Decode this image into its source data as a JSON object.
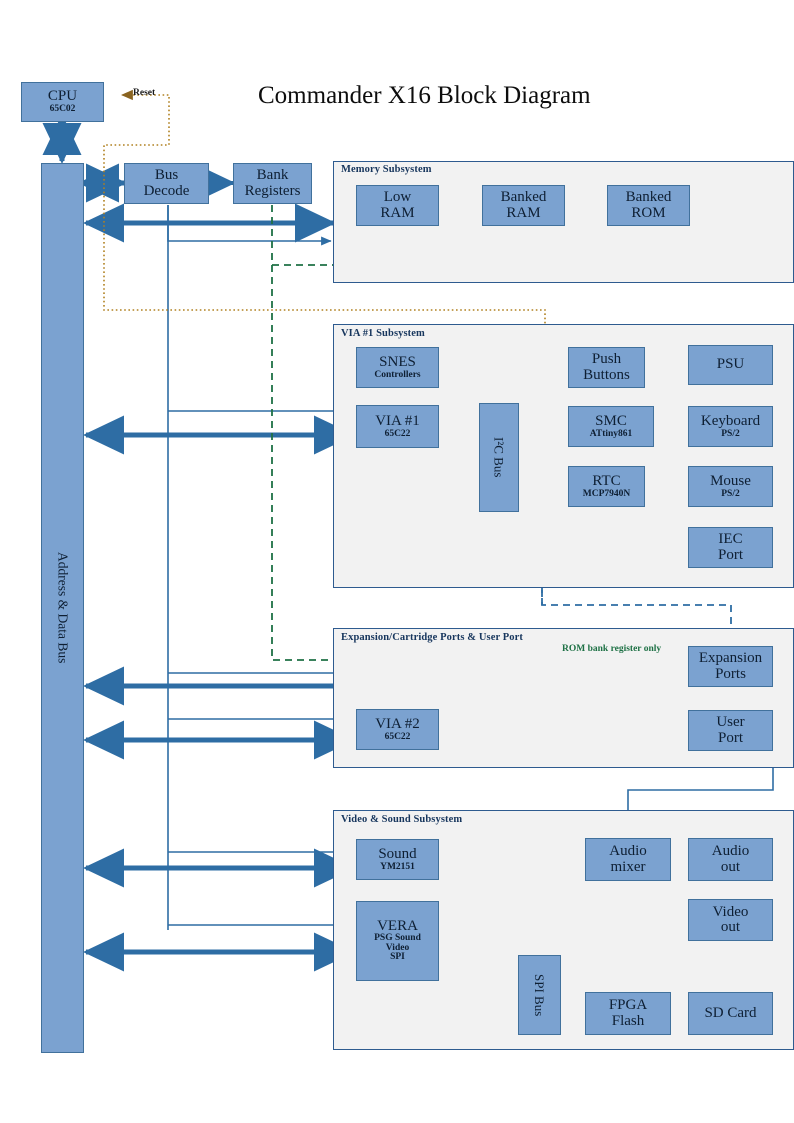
{
  "title": "Commander X16 Block Diagram",
  "colors": {
    "box_fill": "#7ba2d0",
    "box_border": "#41719c",
    "group_fill": "#f2f2f2",
    "group_border": "#2e5b8f",
    "bus_line": "#2e6da4",
    "reset_line": "#b08020",
    "bank_line": "#1e7145",
    "label_text": "#17365d"
  },
  "bus": {
    "label": "Address & Data Bus"
  },
  "cpu": {
    "name": "CPU",
    "part": "65C02"
  },
  "bus_decode": {
    "name": "Bus",
    "name2": "Decode"
  },
  "bank_registers": {
    "name": "Bank",
    "name2": "Registers"
  },
  "wire_labels": {
    "reset": "Reset",
    "rom_bank": "ROM bank register only"
  },
  "groups": [
    {
      "id": "memory",
      "label": "Memory Subsystem"
    },
    {
      "id": "via1",
      "label": "VIA #1 Subsystem"
    },
    {
      "id": "expansion",
      "label": "Expansion/Cartridge Ports & User Port"
    },
    {
      "id": "video",
      "label": "Video & Sound Subsystem"
    }
  ],
  "memory": {
    "low_ram": {
      "name": "Low",
      "name2": "RAM"
    },
    "banked_ram": {
      "name": "Banked",
      "name2": "RAM"
    },
    "banked_rom": {
      "name": "Banked",
      "name2": "ROM"
    }
  },
  "via1_sub": {
    "snes": {
      "name": "SNES",
      "part": "Controllers"
    },
    "via1": {
      "name": "VIA #1",
      "part": "65C22"
    },
    "i2c": {
      "name": "I²C Bus"
    },
    "push": {
      "name": "Push",
      "name2": "Buttons"
    },
    "smc": {
      "name": "SMC",
      "part": "ATtiny861"
    },
    "rtc": {
      "name": "RTC",
      "part": "MCP7940N"
    },
    "psu": {
      "name": "PSU"
    },
    "keyboard": {
      "name": "Keyboard",
      "part": "PS/2"
    },
    "mouse": {
      "name": "Mouse",
      "part": "PS/2"
    },
    "iec": {
      "name": "IEC",
      "name2": "Port"
    }
  },
  "expansion_sub": {
    "expansion_ports": {
      "name": "Expansion",
      "name2": "Ports"
    },
    "via2": {
      "name": "VIA #2",
      "part": "65C22"
    },
    "user_port": {
      "name": "User",
      "name2": "Port"
    }
  },
  "video_sub": {
    "sound": {
      "name": "Sound",
      "part": "YM2151"
    },
    "vera": {
      "name": "VERA",
      "l1": "PSG Sound",
      "l2": "Video",
      "l3": "SPI"
    },
    "audio_mixer": {
      "name": "Audio",
      "name2": "mixer"
    },
    "audio_out": {
      "name": "Audio",
      "name2": "out"
    },
    "video_out": {
      "name": "Video",
      "name2": "out"
    },
    "spi_bus": {
      "name": "SPI Bus"
    },
    "fpga_flash": {
      "name": "FPGA",
      "name2": "Flash"
    },
    "sd_card": {
      "name": "SD Card"
    }
  }
}
